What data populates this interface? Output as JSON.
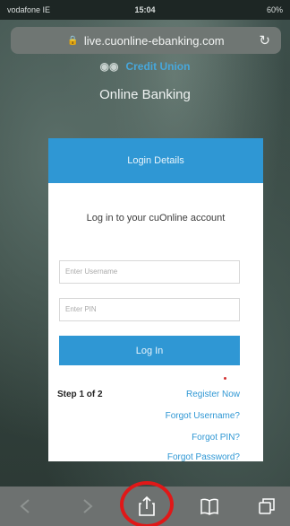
{
  "status_bar": {
    "carrier": "vodafone IE",
    "time": "15:04",
    "battery": "60%"
  },
  "browser": {
    "url": "live.cuonline-ebanking.com"
  },
  "brand": {
    "name": "Credit Union",
    "title": "Online Banking"
  },
  "card": {
    "header": "Login Details",
    "intro": "Log in to your cuOnline account",
    "username_placeholder": "Enter Username",
    "pin_placeholder": "Enter PIN",
    "login_label": "Log In",
    "step": "Step 1 of 2",
    "links": [
      "Register Now",
      "Forgot Username?",
      "Forgot PIN?",
      "Forgot Password?"
    ]
  },
  "toolbar": {
    "items": [
      "back-icon",
      "forward-icon",
      "share-icon",
      "bookmarks-icon",
      "tabs-icon"
    ]
  },
  "colors": {
    "accent": "#2f97d4",
    "highlight": "#e01818"
  }
}
